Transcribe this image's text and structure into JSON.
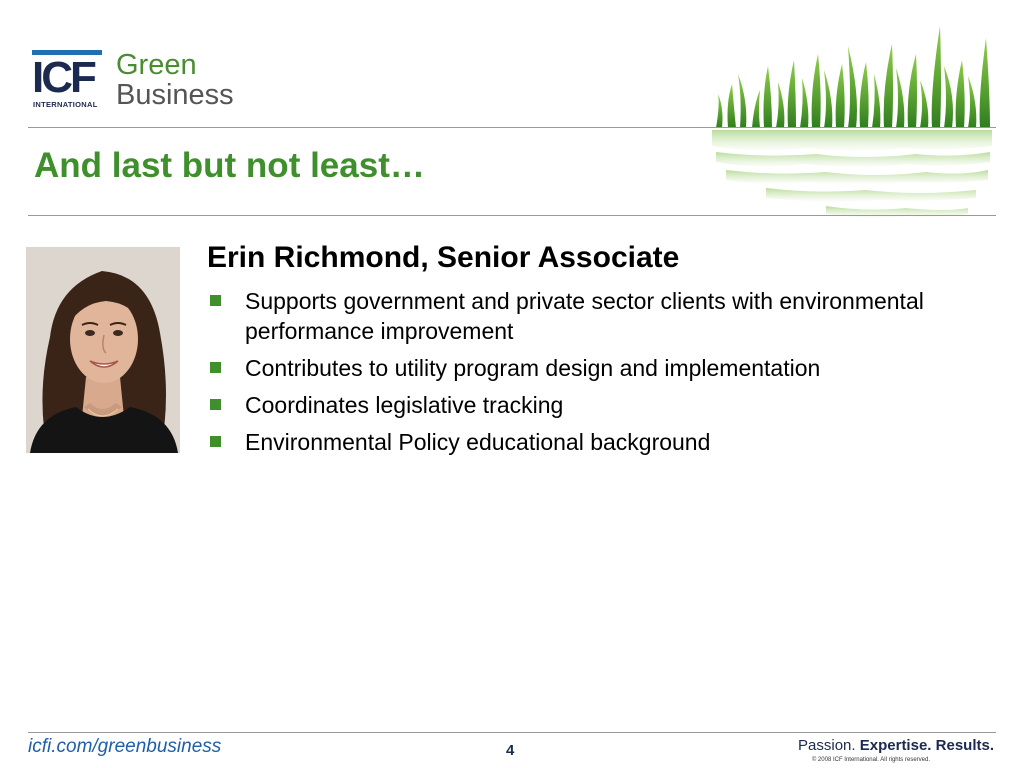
{
  "logo": {
    "icf": "ICF",
    "international": "INTERNATIONAL",
    "green": "Green",
    "business": "Business"
  },
  "header": {
    "title": "And last but not least…"
  },
  "profile": {
    "name": "Erin Richmond, Senior Associate",
    "bullets": [
      "Supports government and private sector clients with environmental performance improvement",
      "Contributes to utility program design and implementation",
      "Coordinates legislative tracking",
      "Environmental Policy educational background"
    ]
  },
  "footer": {
    "url": "icfi.com/greenbusiness",
    "page_number": "4",
    "tagline_passion": "Passion.",
    "tagline_expertise": "Expertise.",
    "tagline_results": "Results.",
    "copyright": "© 2008 ICF International. All rights reserved."
  },
  "colors": {
    "title_green": "#3f8f2d",
    "bullet_green": "#3f8f2d",
    "logo_navy": "#1b2a4e",
    "logo_blue_bar": "#1f6fb2",
    "url_blue": "#1f5fa8"
  }
}
